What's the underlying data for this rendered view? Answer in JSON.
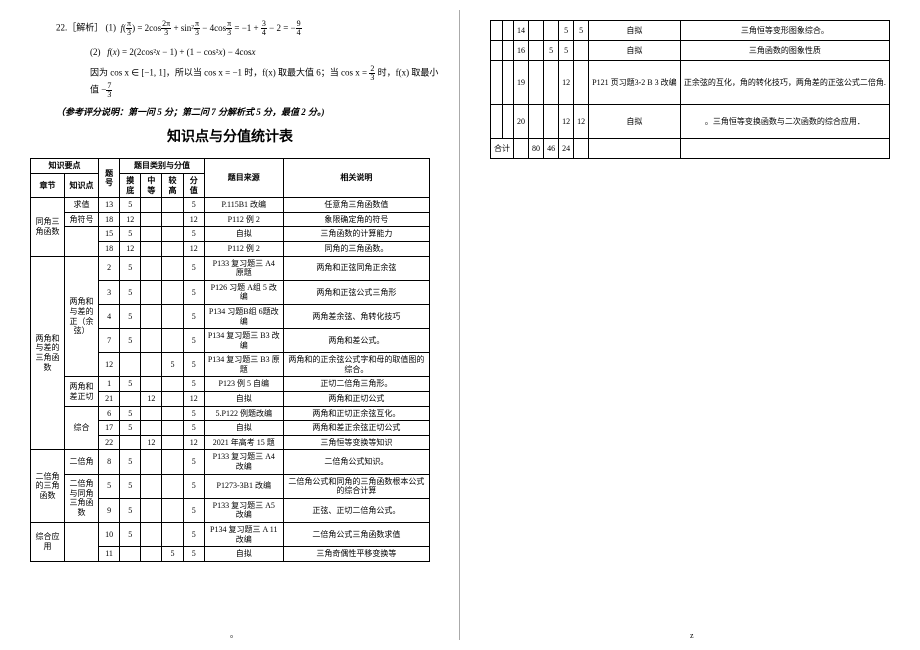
{
  "problem": {
    "number": "22.［解析］",
    "part1_label": "(1)",
    "part1_math": "f(π/3) = 2cos(2π/3) + sin²(π/3) − 4cos(π/3) = −1 + 3/4 − 2 = −9/4",
    "part2_label": "(2)",
    "part2_math": "f(x) = 2(2cos²x − 1) + (1 − cos²x) − 4cosx",
    "explain_prefix": "因为 cos x ∈ [−1, 1]，所以当 cos x = −1 时，f(x) 取最大值 6；当 cos x = ",
    "explain_frac_n": "2",
    "explain_frac_d": "3",
    "explain_mid": " 时，f(x) 取最小值 −",
    "explain_frac2_n": "7",
    "explain_frac2_d": "3",
    "scoring_note": "（参考评分说明：第一问 5 分；第二问 7 分解析式 5 分，最值 2 分。)"
  },
  "title": "知识点与分值统计表",
  "headers": {
    "h1": "知识要点",
    "h2": "题号",
    "h3": "题目类别与分值",
    "h4": "题目来源",
    "h5": "相关说明",
    "s1": "章节",
    "s2": "知识点",
    "s3": "摸底",
    "s4": "中等",
    "s5": "较高",
    "s6": "分值"
  },
  "chapters": {
    "c1": "同角三角函数",
    "c2": "两角和与差的三角函数",
    "c3": "二倍角的三角函数",
    "c4": "综合应用",
    "kp1": "求值",
    "kp2": "角符号",
    "kp3": "两角和与差的正（余弦）",
    "kp4": "两角和差正切",
    "kp5": "综合",
    "kp6": "二倍角",
    "kp7": "二倍角与同角三角函数"
  },
  "rows": [
    {
      "n": "13",
      "c1": "5",
      "c4": "5",
      "src": "P.115B1 改编",
      "note": "任意角三角函数值"
    },
    {
      "n": "18",
      "c1": "12",
      "c4": "12",
      "src": "P112 例 2",
      "note": "象限确定角的符号"
    },
    {
      "n": "15",
      "c1": "5",
      "c4": "5",
      "src": "自拟",
      "note": "三角函数的计算能力"
    },
    {
      "n": "18",
      "c1": "12",
      "c4": "12",
      "src": "P112 例 2",
      "note": "同角的三角函数。"
    },
    {
      "n": "2",
      "c1": "5",
      "c4": "5",
      "src": "P133 复习题三 A4 原题",
      "note": "两角和正弦同角正余弦"
    },
    {
      "n": "3",
      "c1": "5",
      "c4": "5",
      "src": "P126 习题 A组 5 改编",
      "note": "两角和正弦公式三角形"
    },
    {
      "n": "4",
      "c1": "5",
      "c4": "5",
      "src": "P134 习题B组 6题改编",
      "note": "两角差余弦、角转化技巧"
    },
    {
      "n": "7",
      "c1": "5",
      "c4": "5",
      "src": "P134 复习题三 B3 改编",
      "note": "两角和差公式。"
    },
    {
      "n": "12",
      "c3": "5",
      "c4": "5",
      "src": "P134 复习题三 B3 原题",
      "note": "两角和的正余弦公式字和母的取值图的综合。"
    },
    {
      "n": "1",
      "c1": "5",
      "c4": "5",
      "src": "P123 例 5 自编",
      "note": "正切二倍角三角形。"
    },
    {
      "n": "21",
      "c2": "12",
      "c4": "12",
      "src": "自拟",
      "note": "两角和正切公式"
    },
    {
      "n": "6",
      "c1": "5",
      "c4": "5",
      "src": "5.P122 例题改编",
      "note": "两角和正切正余弦互化。"
    },
    {
      "n": "17",
      "c1": "5",
      "c4": "5",
      "src": "自拟",
      "note": "两角和差正余弦正切公式"
    },
    {
      "n": "22",
      "c2": "12",
      "c4": "12",
      "src": "2021 年高考 15 题",
      "note": "三角恒等变换等知识"
    },
    {
      "n": "8",
      "c1": "5",
      "c4": "5",
      "src": "P133 复习题三 A4 改编",
      "note": "二倍角公式知识。"
    },
    {
      "n": "5",
      "c1": "5",
      "c4": "5",
      "src": "P1273-3B1 改编",
      "note": "二倍角公式和同角的三角函数根本公式的综合计算"
    },
    {
      "n": "9",
      "c1": "5",
      "c4": "5",
      "src": "P133 复习题三 A5 改编",
      "note": "正弦、正切二倍角公式。"
    },
    {
      "n": "10",
      "c1": "5",
      "c4": "5",
      "src": "P134 复习题三 A 11 改编",
      "note": "二倍角公式三角函数求值"
    },
    {
      "n": "11",
      "c3": "5",
      "c4": "5",
      "src": "自拟",
      "note": "三角奇偶性平移变换等"
    }
  ],
  "right_rows": [
    {
      "n": "14",
      "c1": "",
      "c2": "",
      "c3": "5",
      "c4": "5",
      "src": "自拟",
      "note": "三角恒等变形图象综合。"
    },
    {
      "n": "16",
      "c1": "",
      "c2": "5",
      "c3": "5",
      "c4": "",
      "src": "自拟",
      "note": "三角函数的图象性质"
    },
    {
      "n": "19",
      "c1": "",
      "c2": "",
      "c3": "12",
      "c4": "",
      "src": "P121 页习题3-2  B 3 改编",
      "note": "正余弦的互化，角的转化技巧，两角差的正弦公式二倍角."
    },
    {
      "n": "20",
      "c1": "",
      "c2": "",
      "c3": "12",
      "c4": "12",
      "src": "自拟",
      "note": "。三角恒等变换函数与二次函数的综合应用．"
    }
  ],
  "totals": {
    "label": "合计",
    "c1": "80",
    "c2": "46",
    "c3": "24",
    "c4": ""
  }
}
